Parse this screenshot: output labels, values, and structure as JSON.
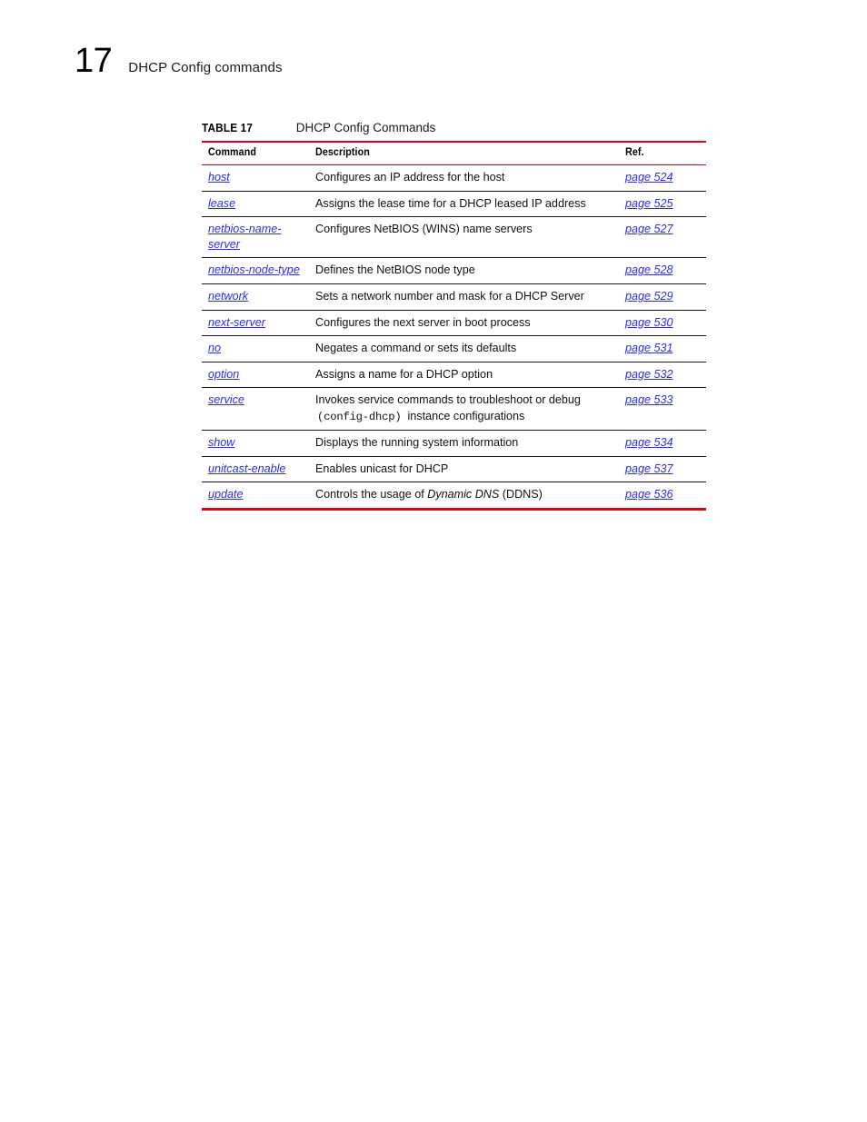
{
  "page": {
    "chapter_number": "17",
    "chapter_title": "DHCP Config commands"
  },
  "colors": {
    "rule_red": "#E3001B",
    "link_blue": "#2D2DE8",
    "rule_black": "#141414"
  },
  "table": {
    "caption_label": "TABLE 17",
    "caption_text": "DHCP Config Commands",
    "columns": [
      {
        "key": "command",
        "label": "Command"
      },
      {
        "key": "description",
        "label": "Description"
      },
      {
        "key": "ref",
        "label": "Ref."
      }
    ],
    "rows": [
      {
        "command": "host",
        "description": "Configures an IP address for the host",
        "ref": "page 524"
      },
      {
        "command": "lease",
        "description": "Assigns the lease time for a DHCP leased IP address",
        "ref": "page 525"
      },
      {
        "command": "netbios-name-server",
        "description": "Configures NetBIOS (WINS) name servers",
        "ref": "page 527"
      },
      {
        "command": "netbios-node-type",
        "description": "Defines the NetBIOS node type",
        "ref": "page 528"
      },
      {
        "command": "network",
        "description": "Sets a network number and mask for a DHCP Server",
        "ref": "page 529"
      },
      {
        "command": "next-server",
        "description": "Configures the next server in boot process",
        "ref": "page 530"
      },
      {
        "command": "no",
        "description": "Negates a command or sets its defaults",
        "ref": "page 531"
      },
      {
        "command": "option",
        "description": "Assigns a name for a DHCP option",
        "ref": "page 532"
      },
      {
        "command": "service",
        "description_line1": "Invokes service commands to troubleshoot or debug",
        "description_mono": "(config-dhcp",
        "description_mono_close": ")",
        "description_line2_tail": "instance configurations",
        "ref": "page 533"
      },
      {
        "command": "show",
        "description": "Displays the running system information",
        "ref": "page 534"
      },
      {
        "command": "unitcast-enable",
        "description": "Enables unicast for DHCP",
        "ref": "page 537"
      },
      {
        "command": "update",
        "description_prefix": "Controls the usage of ",
        "description_italic": "Dynamic DNS",
        "description_suffix": " (DDNS)",
        "ref": "page 536"
      }
    ]
  }
}
